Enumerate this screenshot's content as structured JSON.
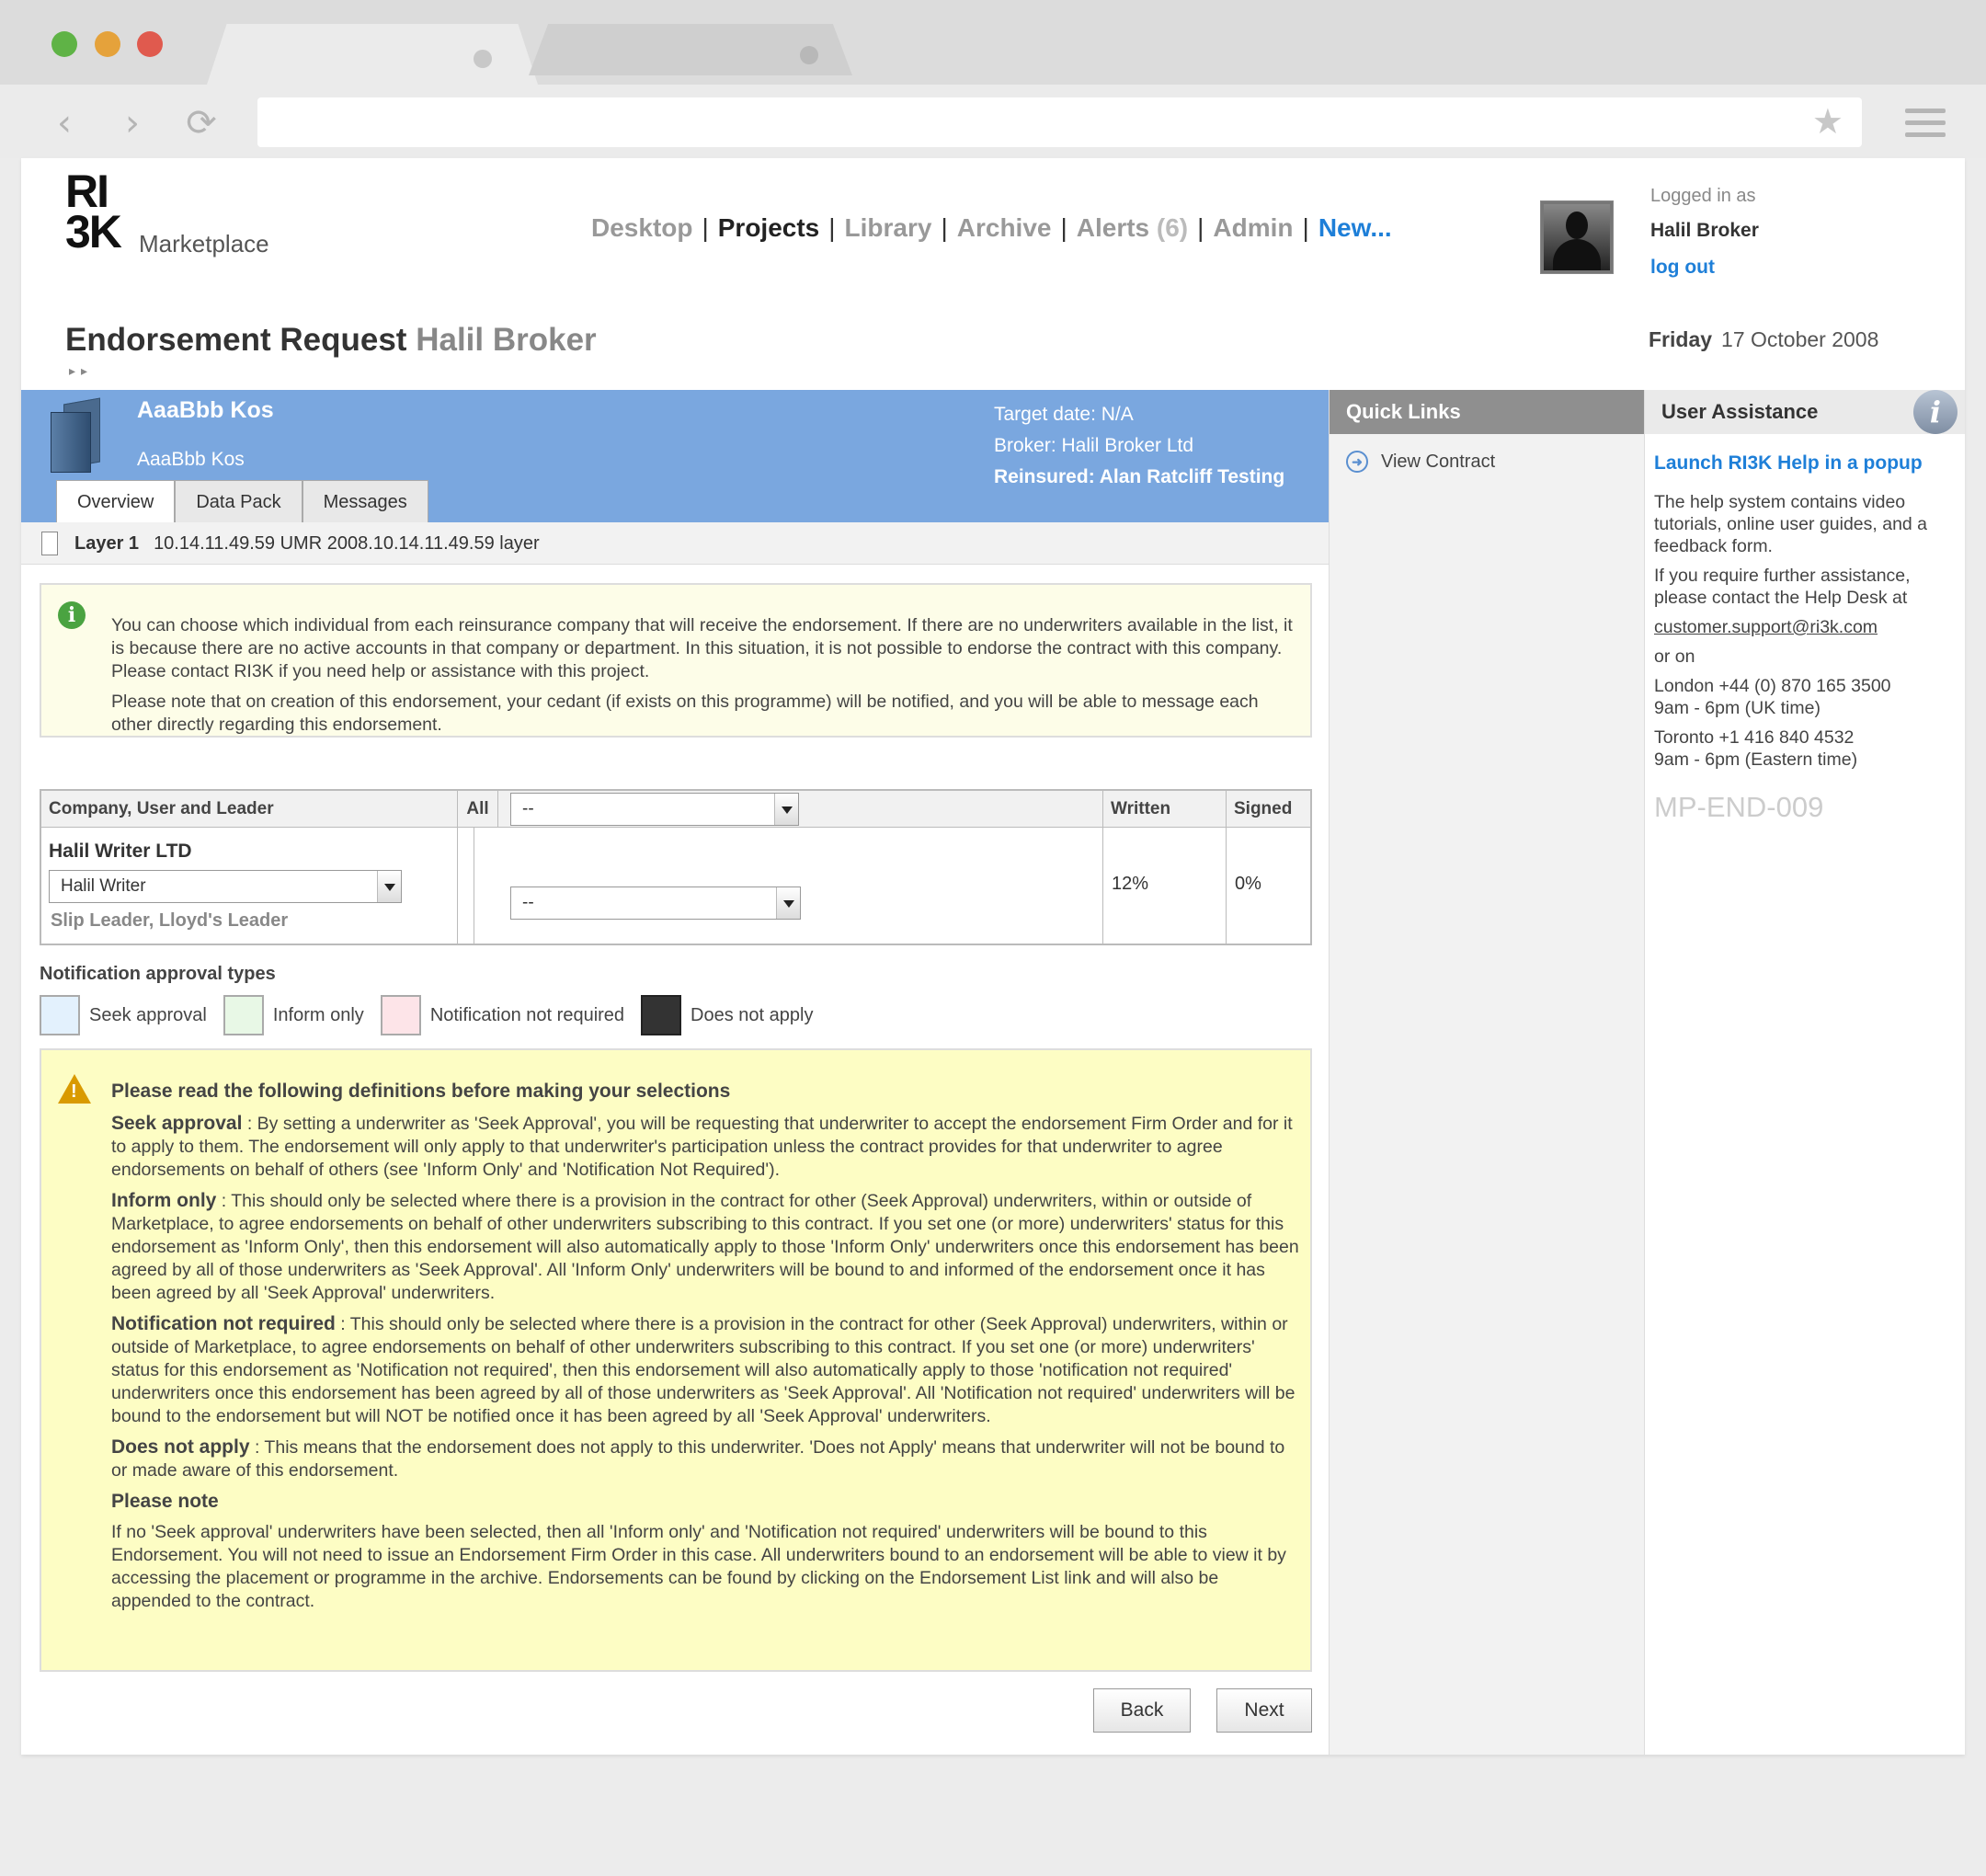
{
  "header": {
    "logo_mark_line1": "RI",
    "logo_mark_line2": "3K",
    "logo_text": "Marketplace",
    "nav": [
      {
        "label": "Desktop"
      },
      {
        "label": "Projects"
      },
      {
        "label": "Library"
      },
      {
        "label": "Archive"
      },
      {
        "label": "Alerts"
      },
      {
        "label": "Admin"
      },
      {
        "label": "New..."
      }
    ],
    "alerts_count": "(6)",
    "logged_in_label": "Logged in as",
    "user_name": "Halil Broker",
    "logout_label": "log out"
  },
  "page": {
    "title": "Endorsement Request",
    "title_user": "Halil Broker",
    "breadcrumb": "▸▸",
    "day": "Friday",
    "date": "17 October 2008"
  },
  "project": {
    "name": "AaaBbb Kos",
    "subtitle": "AaaBbb Kos",
    "target_date": "Target date: N/A",
    "broker": "Broker: Halil Broker Ltd",
    "reinsured": "Reinsured: Alan Ratcliff Testing",
    "tabs": [
      "Overview",
      "Data Pack",
      "Messages"
    ],
    "layer_label": "Layer 1",
    "layer_detail": "10.14.11.49.59 UMR   2008.10.14.11.49.59 layer"
  },
  "info": {
    "para1": "You can choose which individual from each reinsurance company that will receive the endorsement. If there are no underwriters available in the list, it is because there are no active accounts in that company or department. In this situation, it is not possible to endorse the contract with this company. Please contact RI3K if you need help or assistance with this project.",
    "para2": "Please note that on creation of this endorsement, your cedant (if exists on this programme) will be notified, and you will be able to message each other directly regarding this endorsement."
  },
  "table": {
    "headers": {
      "company": "Company, User and Leader",
      "all": "All",
      "written": "Written",
      "signed": "Signed"
    },
    "all_select_value": "--",
    "rows": [
      {
        "company": "Halil Writer LTD",
        "user": "Halil Writer",
        "leader": "Slip Leader, Lloyd's Leader",
        "approval": "--",
        "written": "12%",
        "signed": "0%"
      }
    ]
  },
  "legend": {
    "title": "Notification approval types",
    "items": [
      {
        "label": "Seek approval",
        "color": "#e3f1fd"
      },
      {
        "label": "Inform only",
        "color": "#e8f8e6"
      },
      {
        "label": "Notification not required",
        "color": "#fde4e8"
      },
      {
        "label": "Does not apply",
        "color": "#333333"
      }
    ]
  },
  "definitions": {
    "heading": "Please read the following definitions before making your selections",
    "seek_term": "Seek approval",
    "seek_text": " : By setting a underwriter as 'Seek Approval', you will be requesting that underwriter to accept the endorsement Firm Order and for it to apply to them. The endorsement will only apply to that underwriter's participation unless the contract provides for that underwriter to agree endorsements on behalf of others (see 'Inform Only' and 'Notification Not Required').",
    "inform_term": "Inform only",
    "inform_text": " : This should only be selected where there is a provision in the contract for other (Seek Approval) underwriters, within or outside of Marketplace, to agree endorsements on behalf of other underwriters subscribing to this contract. If you set one (or more) underwriters' status for this endorsement as 'Inform Only', then this endorsement will also automatically apply to those 'Inform Only' underwriters once this endorsement has been agreed by all of those underwriters as 'Seek Approval'. All 'Inform Only' underwriters will be bound to and informed of the endorsement once it has been agreed by all 'Seek Approval' underwriters.",
    "notreq_term": "Notification not required",
    "notreq_text": " : This should only be selected where there is a provision in the contract for other (Seek Approval) underwriters, within or outside of Marketplace, to agree endorsements on behalf of other underwriters subscribing to this contract. If you set one (or more) underwriters' status for this endorsement as 'Notification not required', then this endorsement will also automatically apply to those 'notification not required' underwriters once this endorsement has been agreed by all of those underwriters as 'Seek Approval'. All 'Notification not required' underwriters will be bound to the endorsement but will NOT be notified once it has been agreed by all 'Seek Approval' underwriters.",
    "dna_term": "Does not apply",
    "dna_text": " : This means that the endorsement does not apply to this underwriter. 'Does not Apply' means that underwriter will not be bound to or made aware of this endorsement.",
    "note_heading": "Please note",
    "note_text": "If no 'Seek approval' underwriters have been selected, then all 'Inform only' and 'Notification not required' underwriters will be bound to this Endorsement. You will not need to issue an Endorsement Firm Order in this case. All underwriters bound to an endorsement will be able to view it by accessing the placement or programme in the archive. Endorsements can be found by clicking on the Endorsement List link and will also be appended to the contract."
  },
  "buttons": {
    "back": "Back",
    "next": "Next"
  },
  "quick_links": {
    "title": "Quick Links",
    "items": [
      {
        "label": "View Contract"
      }
    ]
  },
  "assistance": {
    "title": "User Assistance",
    "help_link": "Launch RI3K Help in a popup",
    "para1": "The help system contains video tutorials, online user guides, and a feedback form.",
    "para2": "If you require further assistance, please contact the Help Desk at",
    "email": "customer.support@ri3k.com",
    "or_on": "or on",
    "london_phone": "London +44 (0) 870 165 3500",
    "london_hours": "9am - 6pm (UK time)",
    "toronto_phone": "Toronto +1 416 840 4532",
    "toronto_hours": "9am - 6pm (Eastern time)",
    "screen_code": "MP-END-009"
  },
  "icons": [
    "back-arrow-icon",
    "forward-arrow-icon",
    "reload-icon",
    "star-icon",
    "menu-icon",
    "folder-icon",
    "document-icon",
    "info-icon",
    "warning-icon",
    "circle-arrow-icon",
    "dropdown-arrow-icon"
  ]
}
